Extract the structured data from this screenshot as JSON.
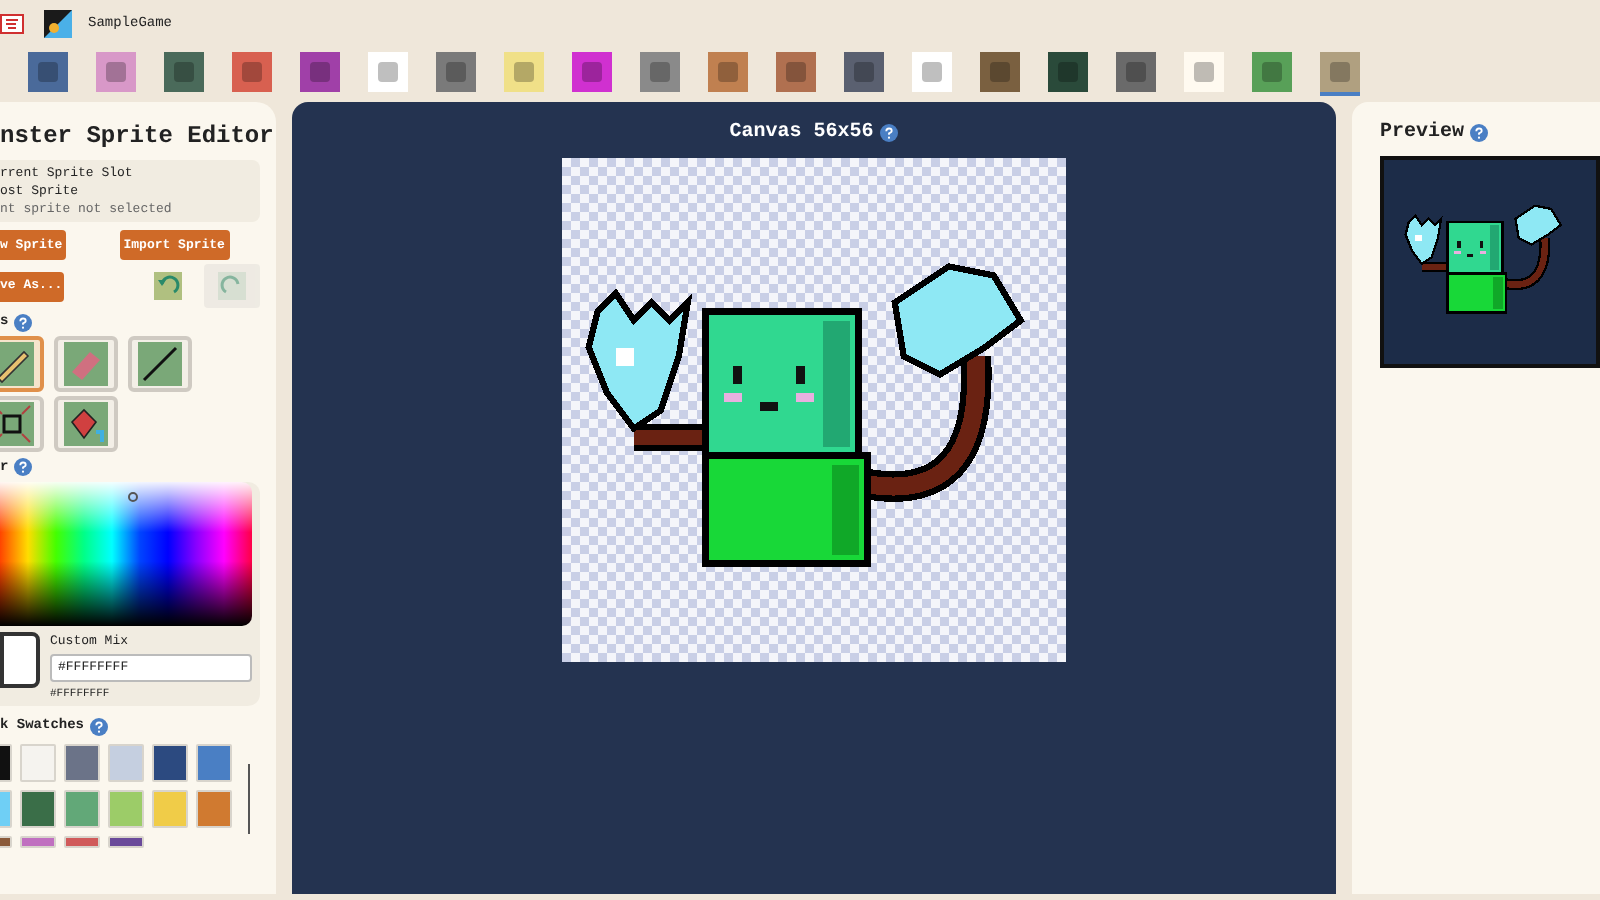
{
  "header": {
    "game_name": "SampleGame"
  },
  "toolbar": [
    {
      "selected": false,
      "color": "#4a6a9a"
    },
    {
      "selected": false,
      "color": "#d898c8"
    },
    {
      "selected": false,
      "color": "#4a6a5a"
    },
    {
      "selected": false,
      "color": "#d86050"
    },
    {
      "selected": false,
      "color": "#a040a8"
    },
    {
      "selected": false,
      "color": "#ffffff"
    },
    {
      "selected": false,
      "color": "#7a7a7a"
    },
    {
      "selected": false,
      "color": "#f0e088"
    },
    {
      "selected": false,
      "color": "#d030d0"
    },
    {
      "selected": false,
      "color": "#8a8a8a"
    },
    {
      "selected": false,
      "color": "#c08050"
    },
    {
      "selected": false,
      "color": "#b07050"
    },
    {
      "selected": false,
      "color": "#5a6070"
    },
    {
      "selected": false,
      "color": "#ffffff"
    },
    {
      "selected": false,
      "color": "#7a6040"
    },
    {
      "selected": false,
      "color": "#2a4a3a"
    },
    {
      "selected": false,
      "color": "#6a6a6a"
    },
    {
      "selected": false,
      "color": "#fffaf0"
    },
    {
      "selected": false,
      "color": "#58a058"
    },
    {
      "selected": true,
      "color": "#b0a080"
    }
  ],
  "editor": {
    "title": "nster Sprite Editor",
    "slot_info": [
      "rrent Sprite Slot",
      "ost Sprite",
      "nt sprite not selected"
    ],
    "buttons": [
      {
        "label": "w Sprite"
      },
      {
        "label": "Import Sprite"
      },
      {
        "label": "ve As..."
      }
    ],
    "undo": {
      "disabled": false
    },
    "redo": {
      "disabled": true
    },
    "tools_heading": "s",
    "tools": [
      {
        "kind": "pencil",
        "selected": true
      },
      {
        "kind": "eraser",
        "selected": false
      },
      {
        "kind": "line",
        "selected": false
      },
      {
        "kind": "select",
        "selected": false
      },
      {
        "kind": "fill",
        "selected": false
      }
    ],
    "color_heading": "r",
    "custom_mix": {
      "label": "Custom Mix",
      "value": "#FFFFFFFF",
      "hex": "#FFFFFFFF"
    },
    "swatches_heading": "k Swatches",
    "swatches": [
      {
        "color": "#111111"
      },
      {
        "color": "#f5f3ef"
      },
      {
        "color": "#6b7388"
      },
      {
        "color": "#c5cfe0"
      },
      {
        "color": "#2c4a80"
      },
      {
        "color": "#4a7fc4"
      },
      {
        "color": "#6fcff5"
      },
      {
        "color": "#3a6e48"
      },
      {
        "color": "#62a878"
      },
      {
        "color": "#9ccc68"
      },
      {
        "color": "#f0cc48"
      },
      {
        "color": "#d07a30"
      },
      {
        "color": "#8a5a3a"
      },
      {
        "color": "#c070c0"
      },
      {
        "color": "#d05a5a"
      },
      {
        "color": "#6a4a9a"
      }
    ]
  },
  "canvas": {
    "title": "Canvas 56x56"
  },
  "preview": {
    "title": "Preview"
  }
}
